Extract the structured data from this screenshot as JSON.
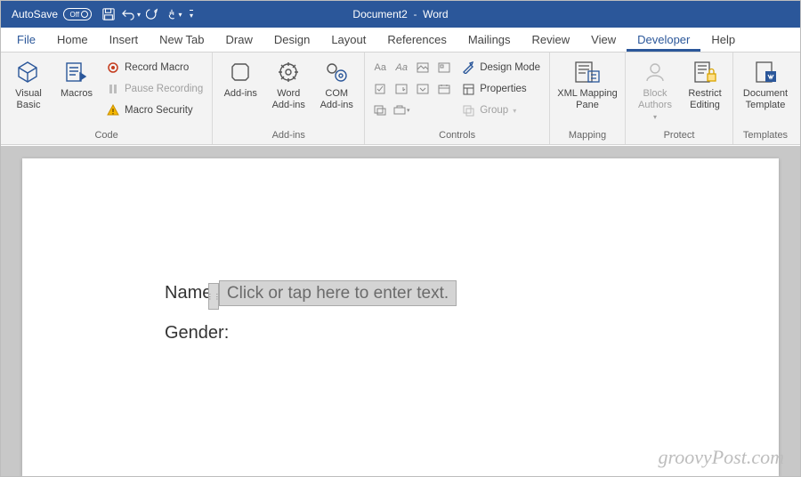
{
  "titlebar": {
    "autosave_label": "AutoSave",
    "autosave_off": "Off",
    "title": "Document2",
    "app": "Word"
  },
  "tabs": {
    "file": "File",
    "home": "Home",
    "insert": "Insert",
    "newtab": "New Tab",
    "draw": "Draw",
    "design": "Design",
    "layout": "Layout",
    "references": "References",
    "mailings": "Mailings",
    "review": "Review",
    "view": "View",
    "developer": "Developer",
    "help": "Help"
  },
  "ribbon": {
    "code": {
      "visual_basic": "Visual Basic",
      "macros": "Macros",
      "record_macro": "Record Macro",
      "pause_recording": "Pause Recording",
      "macro_security": "Macro Security",
      "label": "Code"
    },
    "addins": {
      "addins": "Add-ins",
      "word_addins": "Word Add-ins",
      "com_addins": "COM Add-ins",
      "label": "Add-ins"
    },
    "controls": {
      "design_mode": "Design Mode",
      "properties": "Properties",
      "group": "Group",
      "label": "Controls"
    },
    "mapping": {
      "xml_mapping": "XML Mapping Pane",
      "label": "Mapping"
    },
    "protect": {
      "block_authors": "Block Authors",
      "restrict_editing": "Restrict Editing",
      "label": "Protect"
    },
    "templates": {
      "doc_template": "Document Template",
      "label": "Templates"
    }
  },
  "document": {
    "name_label": "Name:",
    "name_placeholder": "Click or tap here to enter text.",
    "gender_label": "Gender:"
  },
  "watermark": "groovyPost.com"
}
